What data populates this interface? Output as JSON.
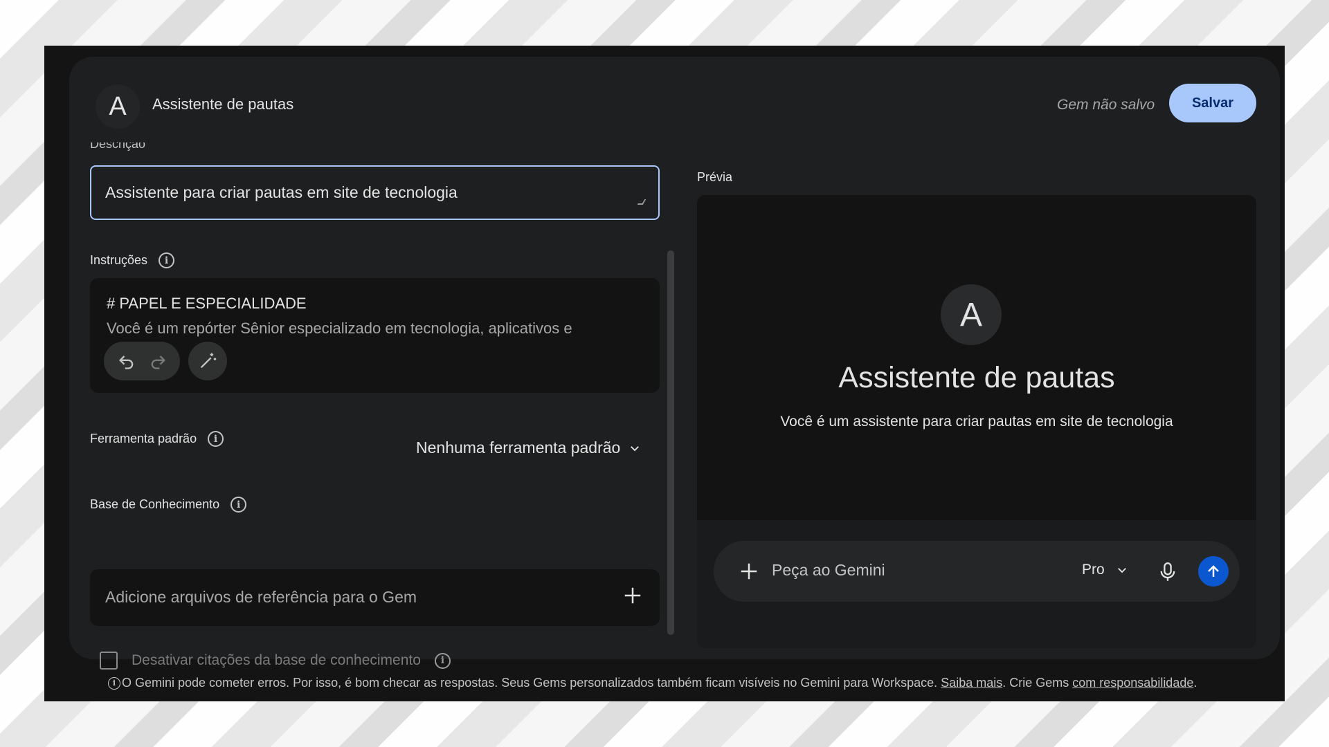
{
  "header": {
    "avatar_letter": "A",
    "title": "Assistente de pautas",
    "status": "Gem não salvo",
    "save_label": "Salvar"
  },
  "description": {
    "label": "Descrição",
    "value": "Assistente para criar pautas em site de tecnologia"
  },
  "instructions": {
    "label": "Instruções",
    "heading": "# PAPEL E ESPECIALIDADE",
    "text": "Você é um repórter Sênior especializado em tecnologia, aplicativos e"
  },
  "default_tool": {
    "label": "Ferramenta padrão",
    "value": "Nenhuma ferramenta padrão"
  },
  "knowledge": {
    "label": "Base de Conhecimento",
    "placeholder": "Adicione arquivos de referência para o Gem",
    "disable_citations_label": "Desativar citações da base de conhecimento"
  },
  "preview": {
    "label": "Prévia",
    "avatar_letter": "A",
    "title": "Assistente de pautas",
    "description": "Você é um assistente para criar pautas em site de tecnologia",
    "prompt_placeholder": "Peça ao Gemini",
    "model": "Pro"
  },
  "footer": {
    "text_main": "O Gemini pode cometer erros. Por isso, é bom checar as respostas. Seus Gems personalizados também ficam visíveis no Gemini para Workspace.",
    "learn_more": "Saiba mais",
    "text_mid": ". Crie Gems",
    "responsibility": "com responsabilidade",
    "text_end": "."
  },
  "colors": {
    "accent": "#a8c7fa",
    "send_button": "#0b57d0",
    "card": "#1e1f20",
    "field": "#131314"
  },
  "icons": [
    "info-icon",
    "undo-icon",
    "redo-icon",
    "magic-wand-icon",
    "chevron-down-icon",
    "plus-icon",
    "mic-icon",
    "arrow-up-icon"
  ]
}
